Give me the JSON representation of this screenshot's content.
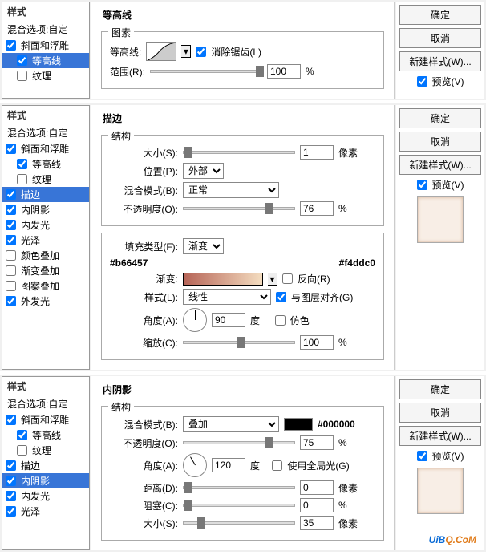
{
  "common": {
    "styles_hdr": "样式",
    "blend_opts": "混合选项:自定",
    "ok": "确定",
    "cancel": "取消",
    "new_style": "新建样式(W)...",
    "preview": "预览(V)",
    "px_unit": "像素",
    "pct": "%",
    "deg": "度"
  },
  "items": {
    "bevel": "斜面和浮雕",
    "contour": "等高线",
    "texture": "纹理",
    "stroke": "描边",
    "inner_shadow": "内阴影",
    "inner_glow": "内发光",
    "gloss": "光泽",
    "color_ov": "颜色叠加",
    "grad_ov": "渐变叠加",
    "pat_ov": "图案叠加",
    "outer_glow": "外发光"
  },
  "p1": {
    "title": "等高线",
    "grp": "图素",
    "contour_lbl": "等高线:",
    "aa": "消除锯齿(L)",
    "range_lbl": "范围(R):",
    "range_val": "100"
  },
  "p2": {
    "title": "描边",
    "grp1": "结构",
    "size_lbl": "大小(S):",
    "size_val": "1",
    "pos_lbl": "位置(P):",
    "pos_val": "外部",
    "blend_lbl": "混合模式(B):",
    "blend_val": "正常",
    "opac_lbl": "不透明度(O):",
    "opac_val": "76",
    "fill_type_lbl": "填充类型(F):",
    "fill_type_val": "渐变",
    "hex1": "#b66457",
    "hex2": "#f4ddc0",
    "grad_lbl": "渐变:",
    "reverse": "反向(R)",
    "style_lbl": "样式(L):",
    "style_val": "线性",
    "align": "与图层对齐(G)",
    "angle_lbl": "角度(A):",
    "angle_val": "90",
    "dither": "仿色",
    "scale_lbl": "缩放(C):",
    "scale_val": "100"
  },
  "p3": {
    "title": "内阴影",
    "grp": "结构",
    "blend_lbl": "混合模式(B):",
    "blend_val": "叠加",
    "hex": "#000000",
    "opac_lbl": "不透明度(O):",
    "opac_val": "75",
    "angle_lbl": "角度(A):",
    "angle_val": "120",
    "global": "使用全局光(G)",
    "dist_lbl": "距离(D):",
    "dist_val": "0",
    "choke_lbl": "阻塞(C):",
    "choke_val": "0",
    "sz_lbl": "大小(S):",
    "sz_val": "35"
  },
  "wm": {
    "a": "UiB",
    "b": "Q.CoM"
  }
}
